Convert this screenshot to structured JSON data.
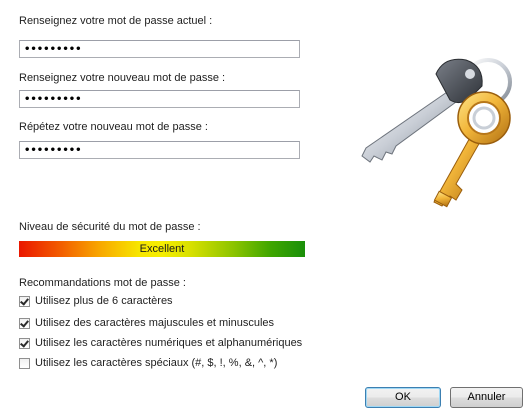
{
  "fields": {
    "current_label": "Renseignez votre mot de passe actuel :",
    "current_value": "•••••••••",
    "new_label": "Renseignez votre nouveau mot de passe :",
    "new_value": "•••••••••",
    "repeat_label": "Répétez votre nouveau mot de passe :",
    "repeat_value": "•••••••••"
  },
  "strength": {
    "label": "Niveau de sécurité du mot de passe :",
    "value": "Excellent"
  },
  "recommendations": {
    "title": "Recommandations mot de passe :",
    "items": [
      {
        "label": "Utilisez plus de 6 caractères",
        "checked": true
      },
      {
        "label": "Utilisez des caractères majuscules et minuscules",
        "checked": true
      },
      {
        "label": "Utilisez les caractères numériques et alphanumériques",
        "checked": true
      },
      {
        "label": "Utilisez les caractères spéciaux (#, $, !, %, &, ^, *)",
        "checked": false
      }
    ]
  },
  "buttons": {
    "ok": "OK",
    "cancel": "Annuler"
  },
  "image": {
    "icon": "keys-icon"
  }
}
